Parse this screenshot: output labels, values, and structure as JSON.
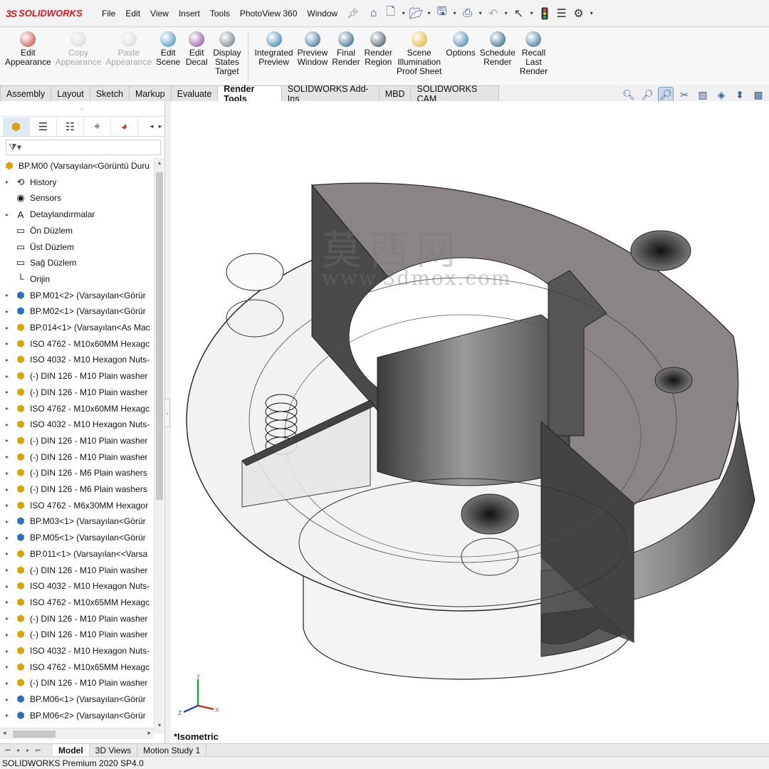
{
  "app": {
    "logo_prefix": "3S",
    "logo_text": "SOLIDWORKS"
  },
  "menu": [
    "File",
    "Edit",
    "View",
    "Insert",
    "Tools",
    "PhotoView 360",
    "Window"
  ],
  "command_manager": [
    {
      "label": "Edit\nAppearance",
      "enabled": true,
      "color": "#c0392b"
    },
    {
      "label": "Copy\nAppearance",
      "enabled": false,
      "color": "#999999"
    },
    {
      "label": "Paste\nAppearance",
      "enabled": false,
      "color": "#999999"
    },
    {
      "label": "Edit\nScene",
      "enabled": true,
      "color": "#2e86c1"
    },
    {
      "label": "Edit\nDecal",
      "enabled": true,
      "color": "#7d3c98"
    },
    {
      "label": "Display\nStates\nTarget",
      "enabled": true,
      "color": "#5d6d7e"
    },
    {
      "label": "Integrated\nPreview",
      "enabled": true,
      "color": "#2471a3"
    },
    {
      "label": "Preview\nWindow",
      "enabled": true,
      "color": "#1f618d"
    },
    {
      "label": "Final\nRender",
      "enabled": true,
      "color": "#1a5276"
    },
    {
      "label": "Render\nRegion",
      "enabled": true,
      "color": "#2e4053"
    },
    {
      "label": "Scene\nIllumination\nProof Sheet",
      "enabled": true,
      "color": "#d4ac0d"
    },
    {
      "label": "Options",
      "enabled": true,
      "color": "#2874a6"
    },
    {
      "label": "Schedule\nRender",
      "enabled": true,
      "color": "#1b4f72"
    },
    {
      "label": "Recall\nLast\nRender",
      "enabled": true,
      "color": "#21618c"
    }
  ],
  "tabs": [
    {
      "label": "Assembly",
      "active": false
    },
    {
      "label": "Layout",
      "active": false
    },
    {
      "label": "Sketch",
      "active": false
    },
    {
      "label": "Markup",
      "active": false
    },
    {
      "label": "Evaluate",
      "active": false
    },
    {
      "label": "Render Tools",
      "active": true
    },
    {
      "label": "SOLIDWORKS Add-Ins",
      "active": false
    },
    {
      "label": "MBD",
      "active": false
    },
    {
      "label": "SOLIDWORKS CAM",
      "active": false
    }
  ],
  "tree": [
    {
      "label": "BP.M00  (Varsayılan<Görüntü Duru",
      "icon": "asm-root",
      "expand": false
    },
    {
      "label": "History",
      "icon": "history",
      "expand": true
    },
    {
      "label": "Sensors",
      "icon": "sensors",
      "expand": false
    },
    {
      "label": "Detaylandırmalar",
      "icon": "annotations",
      "expand": true
    },
    {
      "label": "Ön Düzlem",
      "icon": "plane",
      "expand": false
    },
    {
      "label": "Üst Düzlem",
      "icon": "plane",
      "expand": false
    },
    {
      "label": "Sağ Düzlem",
      "icon": "plane",
      "expand": false
    },
    {
      "label": "Orijin",
      "icon": "origin",
      "expand": false
    },
    {
      "label": "BP.M01<2> (Varsayılan<Görür",
      "icon": "part",
      "expand": true
    },
    {
      "label": "BP.M02<1> (Varsayılan<Görür",
      "icon": "part",
      "expand": true
    },
    {
      "label": "BP.014<1> (Varsayılan<As Mac",
      "icon": "asm",
      "expand": true
    },
    {
      "label": "ISO 4762 - M10x60MM Hexagc",
      "icon": "asm",
      "expand": true
    },
    {
      "label": "ISO 4032 - M10 Hexagon Nuts-",
      "icon": "asm",
      "expand": true
    },
    {
      "label": "(-) DIN 126 - M10 Plain washer",
      "icon": "asm",
      "expand": true
    },
    {
      "label": "(-) DIN 126 - M10 Plain washer",
      "icon": "asm",
      "expand": true
    },
    {
      "label": "ISO 4762 - M10x60MM Hexagc",
      "icon": "asm",
      "expand": true
    },
    {
      "label": "ISO 4032 - M10 Hexagon Nuts-",
      "icon": "asm",
      "expand": true
    },
    {
      "label": "(-) DIN 126 - M10 Plain washer",
      "icon": "asm",
      "expand": true
    },
    {
      "label": "(-) DIN 126 - M10 Plain washer",
      "icon": "asm",
      "expand": true
    },
    {
      "label": "(-) DIN 126 - M6 Plain washers",
      "icon": "asm",
      "expand": true
    },
    {
      "label": "(-) DIN 126 - M6 Plain washers",
      "icon": "asm",
      "expand": true
    },
    {
      "label": "ISO 4762 - M6x30MM Hexagor",
      "icon": "asm",
      "expand": true
    },
    {
      "label": "BP.M03<1> (Varsayılan<Görür",
      "icon": "part",
      "expand": true
    },
    {
      "label": "BP.M05<1> (Varsayılan<Görür",
      "icon": "part",
      "expand": true
    },
    {
      "label": "BP.011<1> (Varsayılan<<Varsa",
      "icon": "asm",
      "expand": true
    },
    {
      "label": "(-) DIN 126 - M10 Plain washer",
      "icon": "asm",
      "expand": true
    },
    {
      "label": "ISO 4032 - M10 Hexagon Nuts-",
      "icon": "asm",
      "expand": true
    },
    {
      "label": "ISO 4762 - M10x65MM Hexagc",
      "icon": "asm",
      "expand": true
    },
    {
      "label": "(-) DIN 126 - M10 Plain washer",
      "icon": "asm",
      "expand": true
    },
    {
      "label": "(-) DIN 126 - M10 Plain washer",
      "icon": "asm",
      "expand": true
    },
    {
      "label": "ISO 4032 - M10 Hexagon Nuts-",
      "icon": "asm",
      "expand": true
    },
    {
      "label": "ISO 4762 - M10x65MM Hexagc",
      "icon": "asm",
      "expand": true
    },
    {
      "label": "(-) DIN 126 - M10 Plain washer",
      "icon": "asm",
      "expand": true
    },
    {
      "label": "BP.M06<1> (Varsayılan<Görür",
      "icon": "part",
      "expand": true
    },
    {
      "label": "BP.M06<2> (Varsayılan<Görür",
      "icon": "part",
      "expand": true
    }
  ],
  "viewport": {
    "view_name": "*Isometric",
    "watermark_cn": "莫西网",
    "watermark_url": "www.3dmox.com",
    "triad": {
      "x": "X",
      "y": "Y",
      "z": "Z"
    }
  },
  "bottom_tabs": [
    {
      "label": "Model",
      "active": true
    },
    {
      "label": "3D Views",
      "active": false
    },
    {
      "label": "Motion Study 1",
      "active": false
    }
  ],
  "status": "SOLIDWORKS Premium 2020 SP4.0"
}
